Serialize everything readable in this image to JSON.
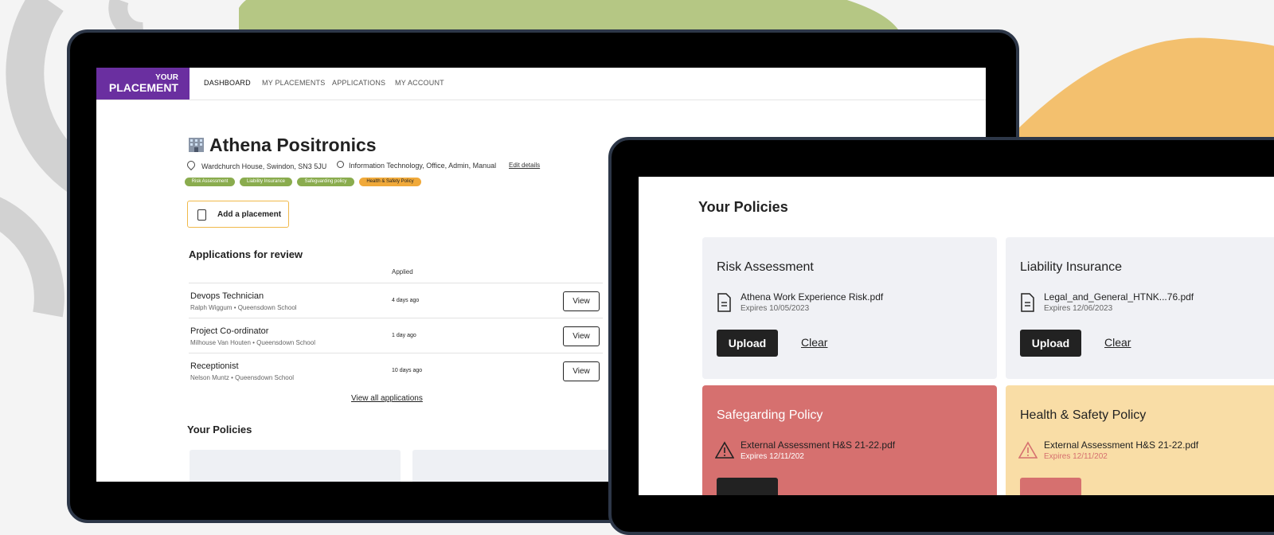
{
  "colors": {
    "brand_purple": "#6a2fa0",
    "risk_tag": "#8aac4e",
    "health_tag": "#f0a93a",
    "danger_card": "#d6706f",
    "warning_card": "#f9dda6",
    "grey_card": "#f0f1f5"
  },
  "logo": {
    "line1": "YOUR",
    "line2": "PLACEMENT"
  },
  "nav": {
    "items": [
      "DASHBOARD",
      "MY PLACEMENTS",
      "APPLICATIONS",
      "MY ACCOUNT"
    ],
    "active": "DASHBOARD"
  },
  "company": {
    "name": "Athena Positronics",
    "address": "Wardchurch House, Swindon, SN3 5JU",
    "sectors": "Information Technology, Office, Admin, Manual",
    "edit_label": "Edit details",
    "tags": [
      "Risk Assessment",
      "Liability Insurance",
      "Safeguarding policy",
      "Health & Safety Policy"
    ]
  },
  "add_placement": {
    "label": "Add a placement"
  },
  "applications": {
    "heading": "Applications for review",
    "column_applied": "Applied",
    "rows": [
      {
        "title": "Devops Technician",
        "sub": "Ralph Wiggum • Queensdown School",
        "applied": "4 days ago",
        "action": "View"
      },
      {
        "title": "Project Co-ordinator",
        "sub": "Milhouse Van Houten • Queensdown School",
        "applied": "1 day ago",
        "action": "View"
      },
      {
        "title": "Receptionist",
        "sub": "Nelson Muntz • Queensdown School",
        "applied": "10 days ago",
        "action": "View"
      }
    ],
    "view_all": "View all applications"
  },
  "policies_heading_small": "Your Policies",
  "policies": {
    "heading": "Your Policies",
    "cards": [
      {
        "title": "Risk Assessment",
        "file": "Athena Work Experience Risk.pdf",
        "expires": "Expires 10/05/2023",
        "upload": "Upload",
        "clear": "Clear",
        "state": "ok",
        "icon": "document-icon"
      },
      {
        "title": "Liability Insurance",
        "file": "Legal_and_General_HTNK...76.pdf",
        "expires": "Expires 12/06/2023",
        "upload": "Upload",
        "clear": "Clear",
        "state": "ok",
        "icon": "document-icon"
      },
      {
        "title": "Safegarding Policy",
        "file": "External Assessment H&S 21-22.pdf",
        "expires": "Expires 12/11/202",
        "state": "expired",
        "icon": "warning-icon"
      },
      {
        "title": "Health & Safety Policy",
        "file": "External Assessment H&S 21-22.pdf",
        "expires": "Expires 12/11/202",
        "state": "warning",
        "icon": "warning-icon"
      }
    ]
  }
}
